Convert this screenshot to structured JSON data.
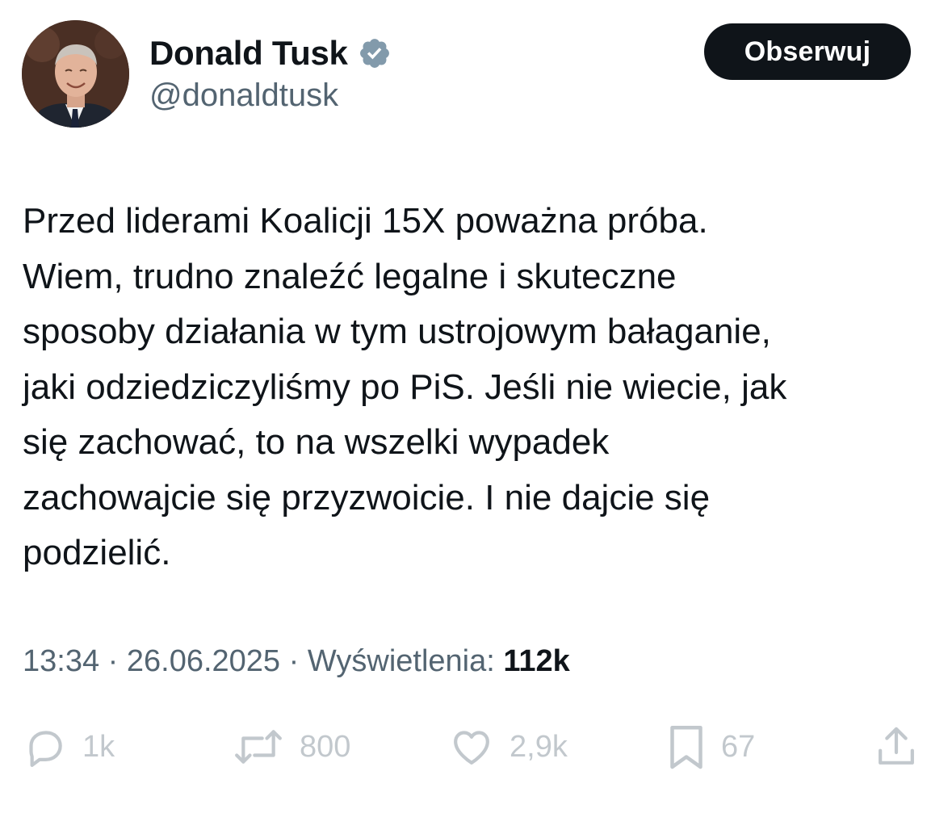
{
  "author": {
    "name": "Donald Tusk",
    "handle": "@donaldtusk",
    "verified_icon": "verified-badge-icon",
    "avatar_icon": "profile-photo"
  },
  "follow_button": {
    "label": "Obserwuj"
  },
  "tweet": {
    "lines": [
      "Przed liderami Koalicji 15X poważna próba.",
      "Wiem, trudno znaleźć legalne i skuteczne",
      "sposoby działania w tym ustrojowym bałaganie,",
      "jaki odziedziczyliśmy po PiS. Jeśli nie wiecie, jak",
      "się zachować, to na wszelki wypadek",
      "zachowajcie się przyzwoicie. I nie dajcie się",
      "podzielić."
    ]
  },
  "meta": {
    "time": "13:34",
    "separator": "·",
    "date": "26.06.2025",
    "views_label": "Wyświetlenia:",
    "views_count": "112k"
  },
  "actions": {
    "reply": {
      "icon": "reply-icon",
      "count": "1k"
    },
    "retweet": {
      "icon": "retweet-icon",
      "count": "800"
    },
    "like": {
      "icon": "heart-icon",
      "count": "2,9k"
    },
    "bookmark": {
      "icon": "bookmark-icon",
      "count": "67"
    },
    "share": {
      "icon": "share-icon"
    }
  },
  "colors": {
    "text_primary": "#0f1419",
    "text_secondary": "#536471",
    "follow_bg": "#0f1419",
    "verified_badge": "#829aab"
  }
}
